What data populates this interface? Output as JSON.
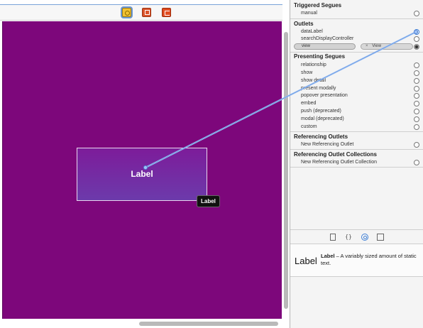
{
  "canvas": {
    "dock_icons": [
      "view-controller-icon",
      "first-responder-icon",
      "exit-icon"
    ],
    "view_background": "#7d077b",
    "label": {
      "text": "Label",
      "badge": "Label"
    }
  },
  "inspector": {
    "triggered_segues": {
      "title": "Triggered Segues",
      "rows": [
        "manual"
      ]
    },
    "outlets": {
      "title": "Outlets",
      "rows": [
        "dataLabel",
        "searchDisplayController"
      ],
      "view_row": {
        "name": "view",
        "target": "View"
      }
    },
    "presenting_segues": {
      "title": "Presenting Segues",
      "rows": [
        "relationship",
        "show",
        "show detail",
        "present modally",
        "popover presentation",
        "embed",
        "push (deprecated)",
        "modal (deprecated)",
        "custom"
      ]
    },
    "referencing_outlets": {
      "title": "Referencing Outlets",
      "rows": [
        "New Referencing Outlet"
      ]
    },
    "referencing_outlet_collections": {
      "title": "Referencing Outlet Collections",
      "rows": [
        "New Referencing Outlet Collection"
      ]
    },
    "library_toolbar_icons": [
      "file-template-icon",
      "code-snippet-icon",
      "object-library-icon",
      "media-library-icon"
    ],
    "library_item": {
      "title": "Label",
      "name": "Label",
      "description": " – A variably sized amount of static text."
    }
  },
  "colors": {
    "connection_line": "#8fb6f2",
    "accent": "#3e7fd6"
  }
}
